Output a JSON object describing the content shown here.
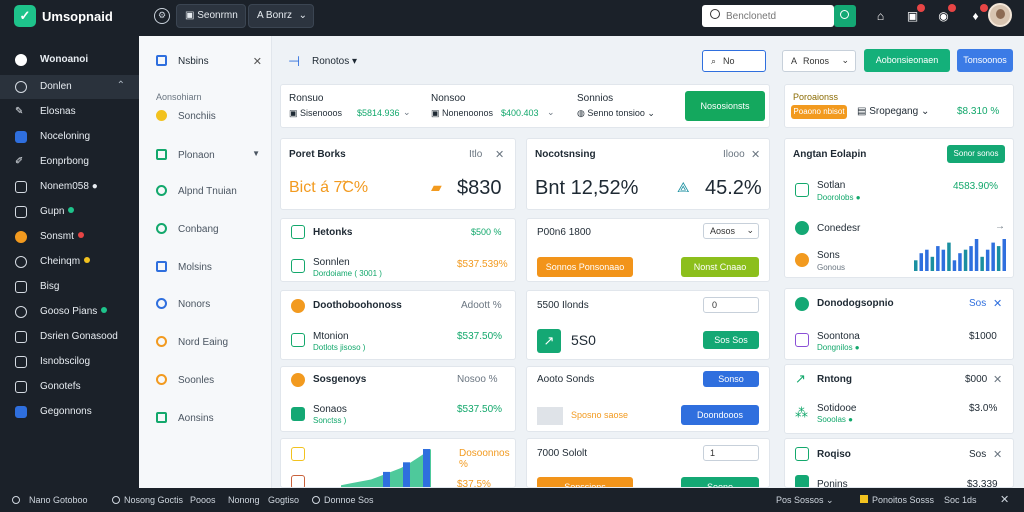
{
  "app": {
    "name": "Umsopnaid"
  },
  "topbar": {
    "button1": "Seonrmn",
    "button2": "Bonrz",
    "search_placeholder": "Benclonetd"
  },
  "sidebar": {
    "header": "Wonoanoi",
    "items": [
      {
        "label": "Donlen",
        "active": true
      },
      {
        "label": "Elosnas"
      },
      {
        "label": "Noceloning"
      },
      {
        "label": "Eonprbong"
      },
      {
        "label": "Nonem058 ●"
      },
      {
        "label": "Gupn"
      },
      {
        "label": "Sonsmt"
      },
      {
        "label": "Cheinqm"
      },
      {
        "label": "Bisg"
      },
      {
        "label": "Gooso Pians"
      },
      {
        "label": "Dsrien Gonasood"
      },
      {
        "label": "Isnobscilog"
      },
      {
        "label": "Gonotefs"
      },
      {
        "label": "Gegonnons"
      }
    ]
  },
  "nav2": {
    "title": "Nsbins",
    "subtitle": "Aonsohiarn",
    "items": [
      {
        "label": "Sonchiis"
      },
      {
        "label": "Plonaon"
      },
      {
        "label": "Alpnd Tnuian"
      },
      {
        "label": "Conbang"
      },
      {
        "label": "Molsins"
      },
      {
        "label": "Nonors"
      },
      {
        "label": "Nord Eaing"
      },
      {
        "label": "Soonles"
      },
      {
        "label": "Aonsins"
      }
    ]
  },
  "toolbar": {
    "title": "Ronotos",
    "select": "No",
    "menu": "Ronos",
    "btn_green": "Aobonsieonaen",
    "btn_blue": "Tonsoonos"
  },
  "summary": {
    "group1_label": "Ronsuo",
    "group1_value": "Sisenooos",
    "group1_amount": "$5814.936",
    "group2_label": "Nonsoo",
    "group2_value": "Nonenoonos",
    "group2_amount": "$400.403",
    "group3_label": "Sonnios",
    "group3_value": "Senno tonsioo",
    "action": "Nososionsts"
  },
  "right_summary": {
    "label": "Poroaionss",
    "tag": "Poaono nbisot",
    "menu": "Sropegang",
    "amount": "$8.310 %"
  },
  "card1": {
    "title": "Poret Borks",
    "meta": "Itlo",
    "big_left": "Bict á 7̃C%",
    "big_right": "$830"
  },
  "card2": {
    "title": "Nocotsnsing",
    "meta": "Ilooo",
    "big_left": "Bnt 12,52%",
    "big_right": "45.2%"
  },
  "card3": {
    "title": "Angtan Eolapin",
    "button": "Sonor sonos",
    "row1_title": "Sotlan",
    "row1_sub": "Doorolobs ●",
    "row1_value": "4583.90%",
    "row2_title": "Conedesr",
    "row3_title": "Sons",
    "row3_sub": "Gonous",
    "bars": [
      3,
      5,
      6,
      4,
      7,
      6,
      8,
      3,
      5,
      6,
      7,
      9,
      4,
      6,
      8,
      7,
      9
    ]
  },
  "list1": {
    "header": "Hetonks",
    "header_value": "$500 %",
    "row1_title": "Sonnlen",
    "row1_sub": "Dordoiame ( 3001 )",
    "row1_value": "$537.539%"
  },
  "list2": {
    "header": "P00n6 1800",
    "select": "Aosos",
    "btn_orange": "Sonnos Ponsonaao",
    "btn_olive": "Nonst Cnaao"
  },
  "list3": {
    "header": "Doothoboohonoss",
    "header_value": "Adoott %",
    "row1_title": "Mtonion",
    "row1_sub": "Dotlots jisoso )",
    "row1_value": "$537.50%"
  },
  "list4": {
    "header": "5500 Ilonds",
    "select": "0",
    "big": "5S0",
    "btn": "Sos Sos"
  },
  "list5": {
    "header": "Sosgenoys",
    "header_value": "Nosoo %",
    "row1_title": "Sonaos",
    "row1_sub": "Sonctss )",
    "row1_value": "$537.50%"
  },
  "list6": {
    "header": "Aooto Sonds",
    "btn": "Sonso",
    "tag": "Sposno saose",
    "btn2": "Doondooos"
  },
  "right_list1": {
    "header": "Donodogsopnio",
    "value": "Sos",
    "row1_title": "Soontona",
    "row1_sub": "Dongnilos ●",
    "row1_value": "$1000"
  },
  "right_list2": {
    "header": "Rntong",
    "value": "$000",
    "row1_title": "Sotidooe",
    "row1_sub": "Sooolas ●",
    "row1_value": "$3.0%"
  },
  "bottom": {
    "header1": "Dosoonnos %",
    "value1": "$37.5%",
    "header2": "7000 Sololt",
    "select": "1",
    "btn_orange": "Sonssions",
    "btn_green": "Soono",
    "header3": "Roqiso",
    "value3": "Sos",
    "row_title": "Ponins",
    "row_value": "$3.339"
  },
  "footer": {
    "items": [
      "Nano Gotoboo",
      "Nosong Goctis",
      "Pooos",
      "Nonong",
      "Gogtiso",
      "Donnoe Sos"
    ],
    "right_items": [
      "Pos Sossos",
      "Ponoitos Sosss",
      "Soc 1ds"
    ]
  },
  "colors": {
    "accent_green": "#13a86c",
    "accent_blue": "#2f6fde",
    "accent_orange": "#f29a1f",
    "sidebar_bg": "#1b2129"
  },
  "chart_bars": [
    4,
    6,
    8,
    10,
    14,
    18,
    22,
    28,
    35,
    42
  ]
}
